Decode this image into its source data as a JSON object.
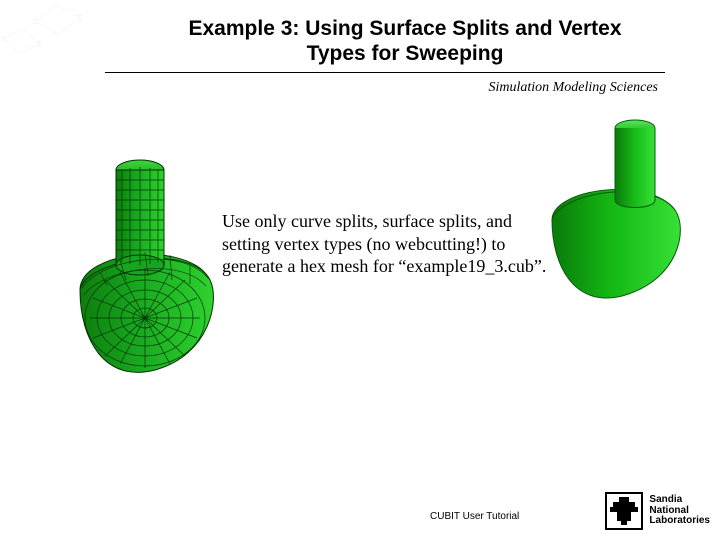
{
  "title_line1": "Example 3: Using Surface Splits and Vertex",
  "title_line2": "Types for Sweeping",
  "subtitle": "Simulation Modeling Sciences",
  "body": "Use only curve splits, surface splits, and setting vertex types (no webcutting!) to generate a hex mesh for “example19_3.cub”.",
  "footer": "CUBIT User Tutorial",
  "sandia_line1": "Sandia",
  "sandia_line2": "National",
  "sandia_line3": "Laboratories",
  "colors": {
    "mesh_fill": "#17a51f",
    "mesh_dark": "#0a6b10",
    "mesh_line": "#003300",
    "solid_fill": "#14b714",
    "solid_dark": "#0d7d0d",
    "solid_top": "#3ad43a"
  }
}
